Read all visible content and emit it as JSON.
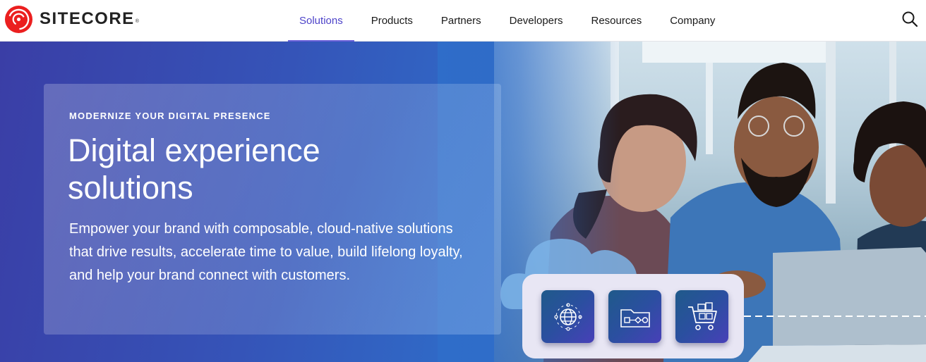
{
  "brand": {
    "name": "SITECORE",
    "trademark": "®",
    "accent_color": "#eb1f1f"
  },
  "nav": {
    "items": [
      {
        "label": "Solutions",
        "active": true
      },
      {
        "label": "Products",
        "active": false
      },
      {
        "label": "Partners",
        "active": false
      },
      {
        "label": "Developers",
        "active": false
      },
      {
        "label": "Resources",
        "active": false
      },
      {
        "label": "Company",
        "active": false
      }
    ],
    "active_color": "#4d43c9",
    "search_icon": "search-icon"
  },
  "hero": {
    "eyebrow": "MODERNIZE YOUR DIGITAL PRESENCE",
    "headline_line1": "Digital experience",
    "headline_line2": "solutions",
    "body": "Empower your brand with composable, cloud-native solutions that drive results, accelerate time to value, build lifelong loyalty, and help your brand connect with customers.",
    "icons": [
      "globe-network-icon",
      "folder-workflow-icon",
      "shopping-cart-icon"
    ]
  }
}
